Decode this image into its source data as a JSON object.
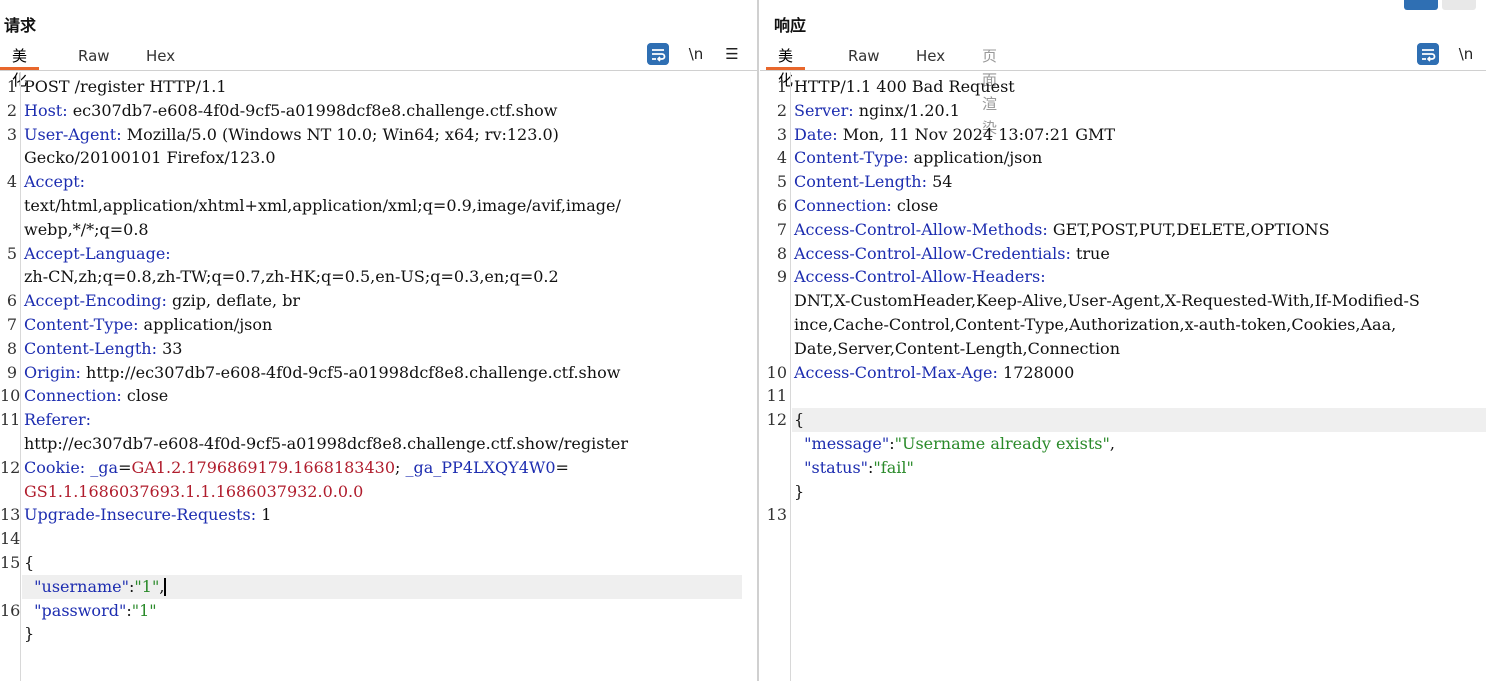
{
  "request": {
    "title": "请求",
    "tabs": [
      "美化",
      "Raw",
      "Hex"
    ],
    "tools": {
      "wrap_icon": "wrap-lines-icon",
      "newline": "\\n",
      "menu": "☰"
    },
    "lines": [
      {
        "n": "1",
        "parts": [
          {
            "t": "POST /register HTTP/1.1",
            "c": ""
          }
        ]
      },
      {
        "n": "2",
        "parts": [
          {
            "t": "Host:",
            "c": "hk"
          },
          {
            "t": " ec307db7-e608-4f0d-9cf5-a01998dcf8e8.challenge.ctf.show",
            "c": ""
          }
        ]
      },
      {
        "n": "3",
        "parts": [
          {
            "t": "User-Agent:",
            "c": "hk"
          },
          {
            "t": " Mozilla/5.0 (Windows NT 10.0; Win64; x64; rv:123.0)",
            "c": ""
          }
        ]
      },
      {
        "n": "",
        "parts": [
          {
            "t": "Gecko/20100101 Firefox/123.0",
            "c": ""
          }
        ]
      },
      {
        "n": "4",
        "parts": [
          {
            "t": "Accept:",
            "c": "hk"
          }
        ]
      },
      {
        "n": "",
        "parts": [
          {
            "t": "text/html,application/xhtml+xml,application/xml;q=0.9,image/avif,image/",
            "c": ""
          }
        ]
      },
      {
        "n": "",
        "parts": [
          {
            "t": "webp,*/*;q=0.8",
            "c": ""
          }
        ]
      },
      {
        "n": "5",
        "parts": [
          {
            "t": "Accept-Language:",
            "c": "hk"
          }
        ]
      },
      {
        "n": "",
        "parts": [
          {
            "t": "zh-CN,zh;q=0.8,zh-TW;q=0.7,zh-HK;q=0.5,en-US;q=0.3,en;q=0.2",
            "c": ""
          }
        ]
      },
      {
        "n": "6",
        "parts": [
          {
            "t": "Accept-Encoding:",
            "c": "hk"
          },
          {
            "t": " gzip, deflate, br",
            "c": ""
          }
        ]
      },
      {
        "n": "7",
        "parts": [
          {
            "t": "Content-Type:",
            "c": "hk"
          },
          {
            "t": " application/json",
            "c": ""
          }
        ]
      },
      {
        "n": "8",
        "parts": [
          {
            "t": "Content-Length:",
            "c": "hk"
          },
          {
            "t": " 33",
            "c": ""
          }
        ]
      },
      {
        "n": "9",
        "parts": [
          {
            "t": "Origin:",
            "c": "hk"
          },
          {
            "t": " http://ec307db7-e608-4f0d-9cf5-a01998dcf8e8.challenge.ctf.show",
            "c": ""
          }
        ]
      },
      {
        "n": "10",
        "parts": [
          {
            "t": "Connection:",
            "c": "hk"
          },
          {
            "t": " close",
            "c": ""
          }
        ]
      },
      {
        "n": "11",
        "parts": [
          {
            "t": "Referer:",
            "c": "hk"
          }
        ]
      },
      {
        "n": "",
        "parts": [
          {
            "t": "http://ec307db7-e608-4f0d-9cf5-a01998dcf8e8.challenge.ctf.show/register",
            "c": ""
          }
        ]
      },
      {
        "n": "12",
        "parts": [
          {
            "t": "Cookie:",
            "c": "hk"
          },
          {
            "t": " _ga",
            "c": "hk"
          },
          {
            "t": "=",
            "c": ""
          },
          {
            "t": "GA1.2.1796869179.1668183430",
            "c": "ck"
          },
          {
            "t": "; ",
            "c": ""
          },
          {
            "t": "_ga_PP4LXQY4W0",
            "c": "hk"
          },
          {
            "t": "=",
            "c": ""
          }
        ]
      },
      {
        "n": "",
        "parts": [
          {
            "t": "GS1.1.1686037693.1.1.1686037932.0.0.0",
            "c": "ck"
          }
        ]
      },
      {
        "n": "13",
        "parts": [
          {
            "t": "Upgrade-Insecure-Requests:",
            "c": "hk"
          },
          {
            "t": " 1",
            "c": ""
          }
        ]
      },
      {
        "n": "14",
        "parts": []
      },
      {
        "n": "15",
        "parts": [
          {
            "t": "{",
            "c": ""
          }
        ]
      },
      {
        "n": "",
        "hl": true,
        "caret": true,
        "parts": [
          {
            "t": "  ",
            "c": ""
          },
          {
            "t": "\"username\"",
            "c": "jk"
          },
          {
            "t": ":",
            "c": ""
          },
          {
            "t": "\"1\"",
            "c": "js"
          },
          {
            "t": ",",
            "c": ""
          }
        ]
      },
      {
        "n": "16",
        "parts": [
          {
            "t": "  ",
            "c": ""
          },
          {
            "t": "\"password\"",
            "c": "jk"
          },
          {
            "t": ":",
            "c": ""
          },
          {
            "t": "\"1\"",
            "c": "js"
          }
        ]
      },
      {
        "n": "",
        "parts": [
          {
            "t": "}",
            "c": ""
          }
        ]
      }
    ]
  },
  "response": {
    "title": "响应",
    "tabs": [
      "美化",
      "Raw",
      "Hex",
      "页面渲染"
    ],
    "tools": {
      "wrap_icon": "wrap-lines-icon",
      "newline": "\\n"
    },
    "lines": [
      {
        "n": "1",
        "parts": [
          {
            "t": "HTTP/1.1 400 Bad Request",
            "c": ""
          }
        ]
      },
      {
        "n": "2",
        "parts": [
          {
            "t": "Server:",
            "c": "hk"
          },
          {
            "t": " nginx/1.20.1",
            "c": ""
          }
        ]
      },
      {
        "n": "3",
        "parts": [
          {
            "t": "Date:",
            "c": "hk"
          },
          {
            "t": " Mon, 11 Nov 2024 13:07:21 GMT",
            "c": ""
          }
        ]
      },
      {
        "n": "4",
        "parts": [
          {
            "t": "Content-Type:",
            "c": "hk"
          },
          {
            "t": " application/json",
            "c": ""
          }
        ]
      },
      {
        "n": "5",
        "parts": [
          {
            "t": "Content-Length:",
            "c": "hk"
          },
          {
            "t": " 54",
            "c": ""
          }
        ]
      },
      {
        "n": "6",
        "parts": [
          {
            "t": "Connection:",
            "c": "hk"
          },
          {
            "t": " close",
            "c": ""
          }
        ]
      },
      {
        "n": "7",
        "parts": [
          {
            "t": "Access-Control-Allow-Methods:",
            "c": "hk"
          },
          {
            "t": " GET,POST,PUT,DELETE,OPTIONS",
            "c": ""
          }
        ]
      },
      {
        "n": "8",
        "parts": [
          {
            "t": "Access-Control-Allow-Credentials:",
            "c": "hk"
          },
          {
            "t": " true",
            "c": ""
          }
        ]
      },
      {
        "n": "9",
        "parts": [
          {
            "t": "Access-Control-Allow-Headers:",
            "c": "hk"
          }
        ]
      },
      {
        "n": "",
        "parts": [
          {
            "t": "DNT,X-CustomHeader,Keep-Alive,User-Agent,X-Requested-With,If-Modified-S",
            "c": ""
          }
        ]
      },
      {
        "n": "",
        "parts": [
          {
            "t": "ince,Cache-Control,Content-Type,Authorization,x-auth-token,Cookies,Aaa,",
            "c": ""
          }
        ]
      },
      {
        "n": "",
        "parts": [
          {
            "t": "Date,Server,Content-Length,Connection",
            "c": ""
          }
        ]
      },
      {
        "n": "10",
        "parts": [
          {
            "t": "Access-Control-Max-Age:",
            "c": "hk"
          },
          {
            "t": " 1728000",
            "c": ""
          }
        ]
      },
      {
        "n": "11",
        "parts": []
      },
      {
        "n": "12",
        "hl": true,
        "parts": [
          {
            "t": "{",
            "c": ""
          }
        ]
      },
      {
        "n": "",
        "parts": [
          {
            "t": "  ",
            "c": ""
          },
          {
            "t": "\"message\"",
            "c": "jk"
          },
          {
            "t": ":",
            "c": ""
          },
          {
            "t": "\"Username already exists\"",
            "c": "js"
          },
          {
            "t": ",",
            "c": ""
          }
        ]
      },
      {
        "n": "",
        "parts": [
          {
            "t": "  ",
            "c": ""
          },
          {
            "t": "\"status\"",
            "c": "jk"
          },
          {
            "t": ":",
            "c": ""
          },
          {
            "t": "\"fail\"",
            "c": "js"
          }
        ]
      },
      {
        "n": "",
        "parts": [
          {
            "t": "}",
            "c": ""
          }
        ]
      },
      {
        "n": "13",
        "parts": []
      }
    ]
  },
  "colors": {
    "accent": "#e8672c",
    "header_key": "#1d2db0",
    "cookie_value": "#b01d2d",
    "json_string": "#2a8a2a",
    "button": "#2f6fb3"
  }
}
